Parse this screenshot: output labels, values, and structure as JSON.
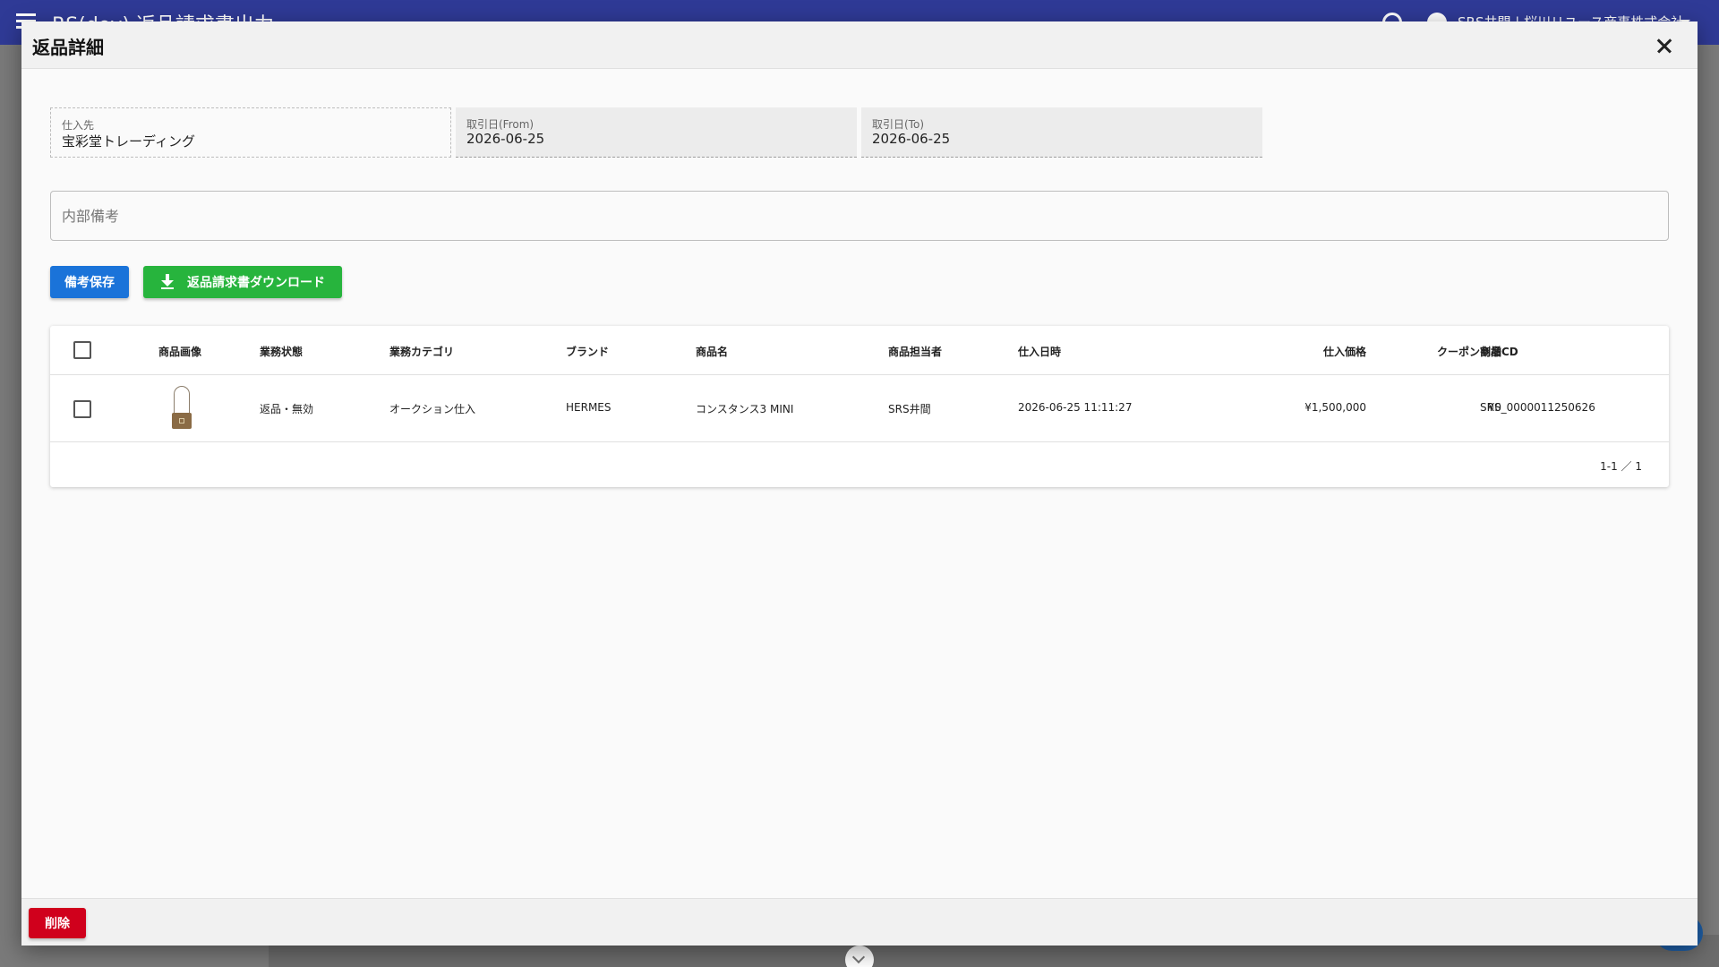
{
  "app": {
    "title": "RS(dev) 返品請求書出力",
    "user": "SRS井間 | 桜川リユース商事株式会社"
  },
  "dialog": {
    "title": "返品詳細",
    "close_icon": "close-icon"
  },
  "filters": {
    "supplier": {
      "label": "仕入先",
      "value": "宝彩堂トレーディング"
    },
    "date_from": {
      "label": "取引日(From)",
      "value": "2026-06-25"
    },
    "date_to": {
      "label": "取引日(To)",
      "value": "2026-06-25"
    }
  },
  "memo": {
    "placeholder": "内部備考",
    "value": ""
  },
  "buttons": {
    "save_memo": "備考保存",
    "download": "返品請求書ダウンロード",
    "delete": "削除"
  },
  "table": {
    "headers": [
      "商品画像",
      "業務状態",
      "業務カテゴリ",
      "ブランド",
      "商品名",
      "商品担当者",
      "仕入日時",
      "仕入価格",
      "クーポン割増",
      "商品CD"
    ],
    "rows": [
      {
        "image_icon": "handbag-icon",
        "status": "返品・無効",
        "category": "オークション仕入",
        "brand": "HERMES",
        "product_name": "コンスタンス3 MINI",
        "staff": "SRS井間",
        "purchase_datetime": "2026-06-25 11:11:27",
        "price": "¥1,500,000",
        "coupon": "¥0",
        "product_cd": "SRS_0000011250626"
      }
    ],
    "pagination": "1-1 ／ 1"
  },
  "colors": {
    "header_bg": "#2f3a96",
    "save_button": "#1a73d9",
    "download_button": "#27b43d",
    "delete_button": "#d0001c"
  }
}
